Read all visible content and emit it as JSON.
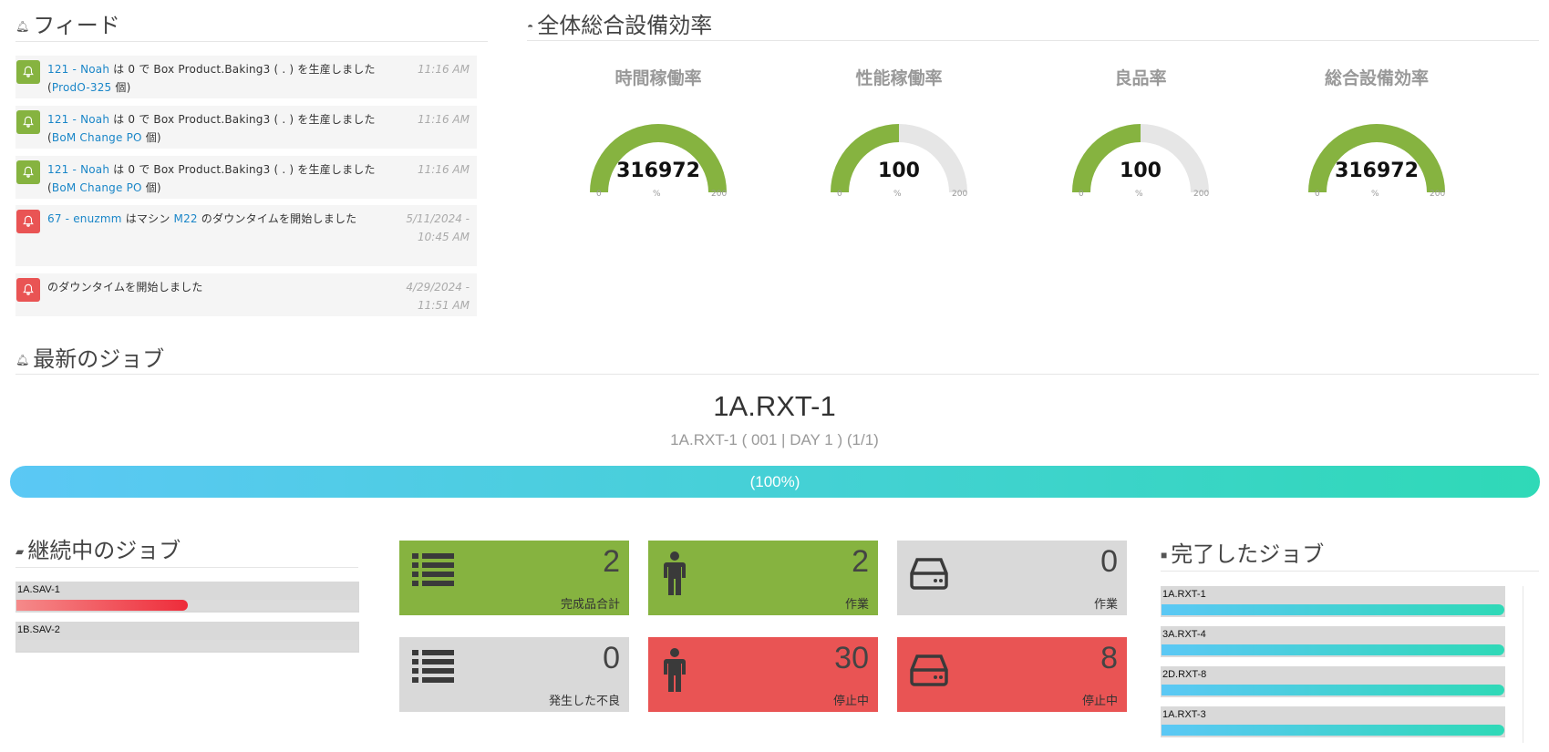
{
  "feed": {
    "title": "フィード",
    "items": [
      {
        "color": "green",
        "link1": "121 - Noah",
        "mid1": " は 0 で Box Product.Baking3 ( . ) を生産しました (",
        "link2": "ProdO-325",
        "end": " 個)",
        "time": "11:16 AM"
      },
      {
        "color": "green",
        "link1": "121 - Noah",
        "mid1": " は 0 で Box Product.Baking3 ( . ) を生産しました (",
        "link2": "BoM Change PO",
        "end": " 個)",
        "time": "11:16 AM"
      },
      {
        "color": "green",
        "link1": "121 - Noah",
        "mid1": " は 0 で Box Product.Baking3 ( . ) を生産しました (",
        "link2": "BoM Change PO",
        "end": " 個)",
        "time": "11:16 AM"
      },
      {
        "color": "red",
        "link1": "67 - enuzmm",
        "mid1": " はマシン ",
        "link2": "M22",
        "end": " のダウンタイムを開始しました",
        "time": "5/11/2024 - 10:45 AM"
      },
      {
        "color": "red",
        "link1": "",
        "mid1": "のダウンタイムを開始しました",
        "link2": "",
        "end": "",
        "time": "4/29/2024 - 11:51 AM"
      }
    ]
  },
  "oee": {
    "title": "全体総合設備効率",
    "gauges": [
      {
        "label": "時間稼働率",
        "value": "316972",
        "fraction": 1.0,
        "min": "0",
        "unit": "%",
        "max": "200"
      },
      {
        "label": "性能稼働率",
        "value": "100",
        "fraction": 0.5,
        "min": "0",
        "unit": "%",
        "max": "200"
      },
      {
        "label": "良品率",
        "value": "100",
        "fraction": 0.5,
        "min": "0",
        "unit": "%",
        "max": "200"
      },
      {
        "label": "総合設備効率",
        "value": "316972",
        "fraction": 1.0,
        "min": "0",
        "unit": "%",
        "max": "200"
      }
    ],
    "colors": {
      "fill": "#86b340",
      "track": "#e6e6e6"
    }
  },
  "latest_job": {
    "title": "最新のジョブ",
    "name": "1A.RXT-1",
    "detail": "1A.RXT-1 ( 001 | DAY 1 ) (1/1)",
    "progress_label": "(100%)",
    "progress": 1.0
  },
  "ongoing_jobs": {
    "title": "継続中のジョブ",
    "items": [
      {
        "label": "1A.SAV-1",
        "progress": 0.5
      },
      {
        "label": "1B.SAV-2",
        "progress": 0.0
      }
    ]
  },
  "tiles": [
    {
      "icon": "list-icon",
      "value": "2",
      "label": "完成品合計",
      "color": "green"
    },
    {
      "icon": "person-icon",
      "value": "2",
      "label": "作業",
      "color": "green"
    },
    {
      "icon": "drive-icon",
      "value": "0",
      "label": "作業",
      "color": "gray"
    },
    {
      "icon": "list-icon",
      "value": "0",
      "label": "発生した不良",
      "color": "gray"
    },
    {
      "icon": "person-icon",
      "value": "30",
      "label": "停止中",
      "color": "red"
    },
    {
      "icon": "drive-icon",
      "value": "8",
      "label": "停止中",
      "color": "red"
    }
  ],
  "completed_jobs": {
    "title": "完了したジョブ",
    "items": [
      {
        "label": "1A.RXT-1",
        "progress": 1.0
      },
      {
        "label": "3A.RXT-4",
        "progress": 1.0
      },
      {
        "label": "2D.RXT-8",
        "progress": 1.0
      },
      {
        "label": "1A.RXT-3",
        "progress": 1.0
      }
    ]
  }
}
